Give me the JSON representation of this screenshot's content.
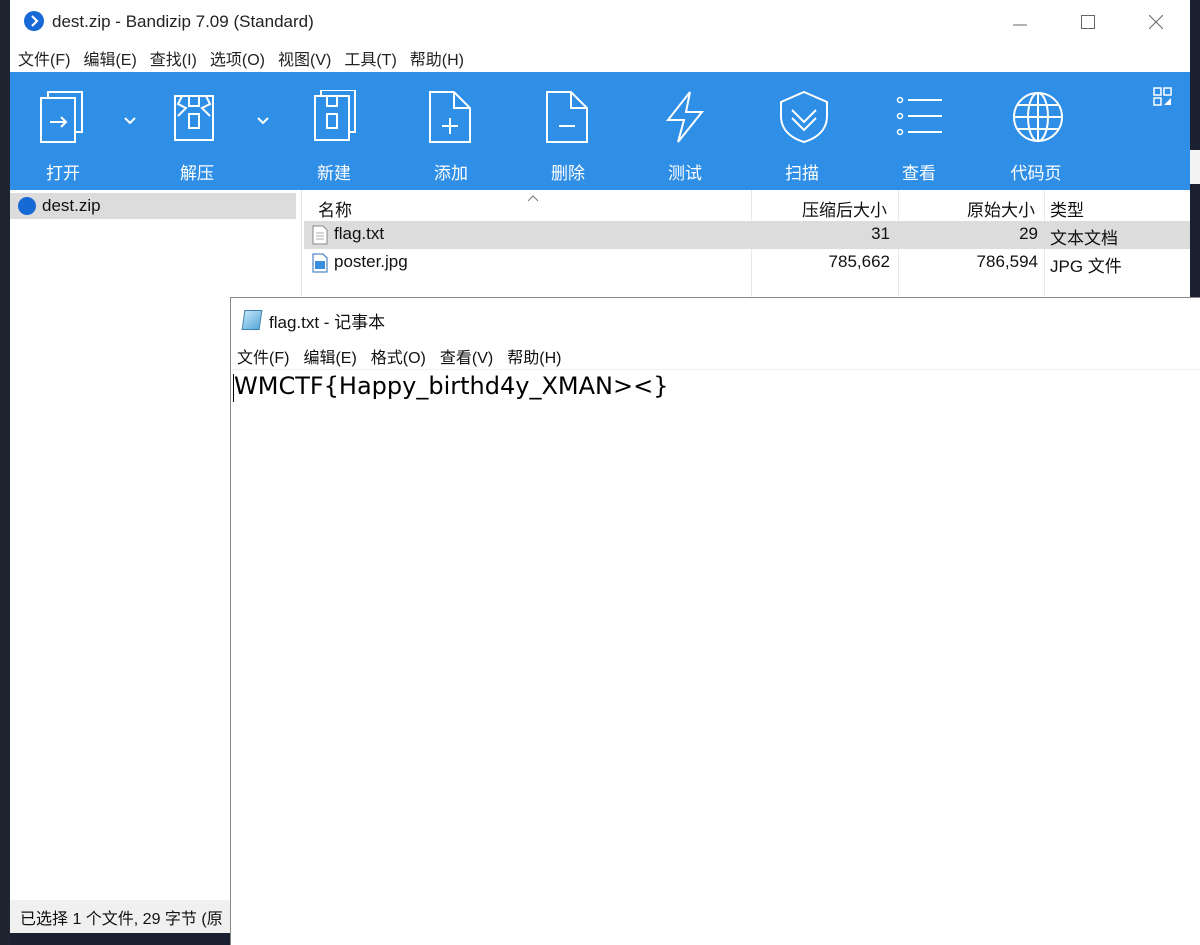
{
  "bandizip": {
    "title": "dest.zip - Bandizip 7.09 (Standard)",
    "menu": [
      "文件(F)",
      "编辑(E)",
      "查找(I)",
      "选项(O)",
      "视图(V)",
      "工具(T)",
      "帮助(H)"
    ],
    "toolbar": {
      "open": "打开",
      "extract": "解压",
      "new": "新建",
      "add": "添加",
      "delete": "删除",
      "test": "测试",
      "scan": "扫描",
      "view": "查看",
      "codepage": "代码页"
    },
    "tree": {
      "root": "dest.zip"
    },
    "columns": {
      "name": "名称",
      "compressed": "压缩后大小",
      "original": "原始大小",
      "type": "类型"
    },
    "files": [
      {
        "name": "flag.txt",
        "compressed": "31",
        "original": "29",
        "type": "文本文档"
      },
      {
        "name": "poster.jpg",
        "compressed": "785,662",
        "original": "786,594",
        "type": "JPG 文件"
      }
    ],
    "status": "已选择 1 个文件, 29 字节 (原"
  },
  "notepad": {
    "title": "flag.txt - 记事本",
    "menu": [
      "文件(F)",
      "编辑(E)",
      "格式(O)",
      "查看(V)",
      "帮助(H)"
    ],
    "content": "WMCTF{Happy_birthd4y_XMAN><}"
  },
  "colors": {
    "toolbar": "#2f8ee6",
    "selection": "#dcdcdc",
    "brand": "#1769d6"
  }
}
